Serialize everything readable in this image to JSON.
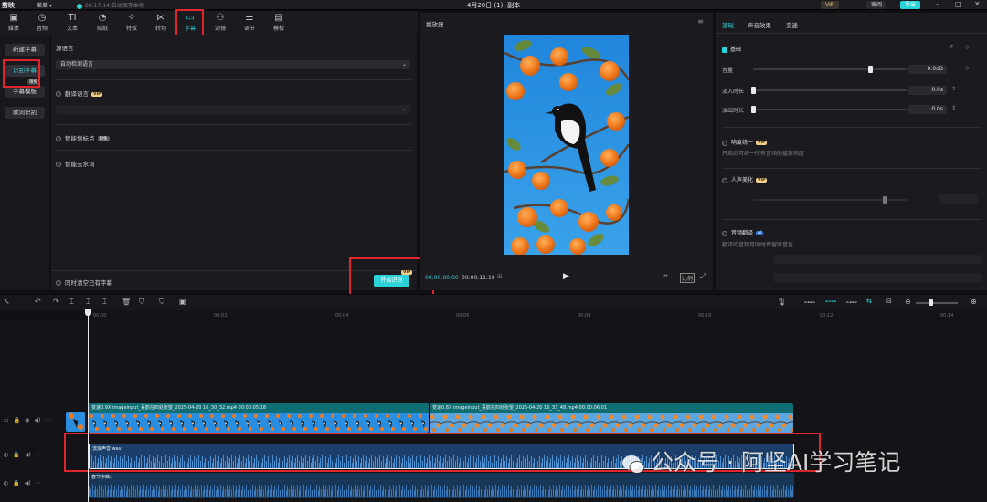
{
  "titlebar": {
    "logo": "剪映",
    "menu": "菜单 ▾",
    "save_status": "00:17:14 自动保存本地",
    "title": "4月20日 (1) -副本",
    "vip": "VIP",
    "review": "审阅",
    "export": "导出"
  },
  "tool_tabs": [
    {
      "label": "媒体",
      "icon": "media-icon"
    },
    {
      "label": "音频",
      "icon": "audio-icon"
    },
    {
      "label": "文本",
      "icon": "text-icon"
    },
    {
      "label": "贴纸",
      "icon": "sticker-icon"
    },
    {
      "label": "特效",
      "icon": "effects-icon"
    },
    {
      "label": "转场",
      "icon": "transition-icon"
    },
    {
      "label": "字幕",
      "icon": "caption-icon"
    },
    {
      "label": "滤镜",
      "icon": "filter-icon"
    },
    {
      "label": "调节",
      "icon": "adjust-icon"
    },
    {
      "label": "模板",
      "icon": "template-icon"
    }
  ],
  "left_nav": [
    "新建字幕",
    "识别字幕",
    "字幕模板",
    "歌词识别"
  ],
  "left_nav_badge": "限免",
  "caption_panel": {
    "source_language_label": "源语言",
    "source_language_value": "自动检测语言",
    "translate_label": "翻译语言",
    "translate_badge": "VIP",
    "filler_label": "智能划标点",
    "filler_badge": "限免",
    "dewater_label": "智能去水词",
    "clear_existing_label": "同时清空已有字幕",
    "start_button": "开始识别",
    "start_badge": "VIP"
  },
  "player": {
    "title": "播放器",
    "current_time": "00:00:00:00",
    "total_time": "00:00:11:19",
    "ratio_label": "比例"
  },
  "inspector": {
    "tabs": [
      "基础",
      "声音效果",
      "变速"
    ],
    "basic_section": "基础",
    "volume_label": "音量",
    "volume_value": "0.0dB",
    "fadein_label": "淡入时长",
    "fadein_value": "0.0s",
    "fadeout_label": "淡出时长",
    "fadeout_value": "0.0s",
    "loudness_label": "响度统一",
    "loudness_badge": "VIP",
    "loudness_desc": "开启后可统一所有音频的播放响度",
    "voice_beautify_label": "人声美化",
    "voice_beautify_badge": "VIP",
    "audio_translate_label": "音频翻译",
    "audio_translate_badge": "AI",
    "audio_translate_desc": "翻译的音频可同时保留原音色"
  },
  "timeline": {
    "ticks": [
      "00:00",
      "00:02",
      "00:04",
      "00:06",
      "00:08",
      "00:10",
      "00:12",
      "00:14"
    ],
    "clip1_label": "变速0.9X  imageinput_喜鹊在四处张望_2025-04-20 16_30_32.mp4  00:00:05:18",
    "clip2_label": "变速0.8X  imageinput_喜鹊在四处张望_2025-04-20 16_33_48.mp4  00:00:06:01",
    "audio1_label": "流浪声音.wav",
    "audio2_label": "春节序曲1"
  },
  "watermark": "公众号 · 阿坚AI学习笔记",
  "colors": {
    "accent": "#2bd3d8",
    "highlight_box": "#e0262b",
    "vip": "#f3cf8a"
  }
}
